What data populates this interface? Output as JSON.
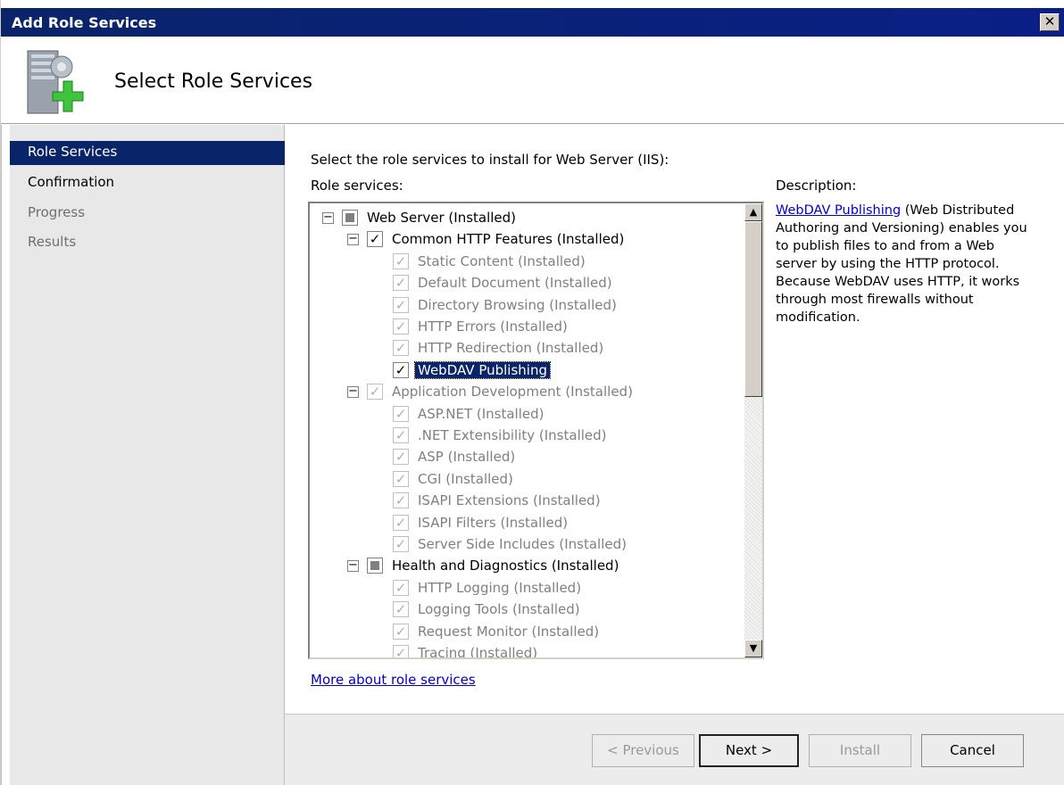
{
  "window": {
    "title": "Add Role Services",
    "close_glyph": "✕"
  },
  "header": {
    "title": "Select Role Services",
    "icon": "server-add-icon"
  },
  "sidebar": {
    "items": [
      {
        "label": "Role Services",
        "state": "active"
      },
      {
        "label": "Confirmation",
        "state": "normal"
      },
      {
        "label": "Progress",
        "state": "disabled"
      },
      {
        "label": "Results",
        "state": "disabled"
      }
    ]
  },
  "main": {
    "intro": "Select the role services to install for Web Server (IIS):",
    "role_services_label": "Role services:",
    "description_label": "Description:",
    "description_link": "WebDAV Publishing",
    "description_text": " (Web Distributed Authoring and Versioning) enables you to publish files to and from a Web server by using the HTTP protocol. Because WebDAV uses HTTP, it works through most firewalls without modification.",
    "more_link": "More about role services"
  },
  "tree": [
    {
      "label": "Web Server  (Installed)",
      "level": 0,
      "expander": "−",
      "check": "partial",
      "grey": false
    },
    {
      "label": "Common HTTP Features  (Installed)",
      "level": 1,
      "expander": "−",
      "check": "checked",
      "grey": false
    },
    {
      "label": "Static Content  (Installed)",
      "level": 2,
      "check": "checked",
      "grey": true
    },
    {
      "label": "Default Document  (Installed)",
      "level": 2,
      "check": "checked",
      "grey": true
    },
    {
      "label": "Directory Browsing  (Installed)",
      "level": 2,
      "check": "checked",
      "grey": true
    },
    {
      "label": "HTTP Errors  (Installed)",
      "level": 2,
      "check": "checked",
      "grey": true
    },
    {
      "label": "HTTP Redirection  (Installed)",
      "level": 2,
      "check": "checked",
      "grey": true
    },
    {
      "label": "WebDAV Publishing",
      "level": 2,
      "check": "checked",
      "grey": false,
      "selected": true
    },
    {
      "label": "Application Development  (Installed)",
      "level": 1,
      "expander": "−",
      "check": "checked",
      "grey": true
    },
    {
      "label": "ASP.NET  (Installed)",
      "level": 2,
      "check": "checked",
      "grey": true
    },
    {
      "label": ".NET Extensibility  (Installed)",
      "level": 2,
      "check": "checked",
      "grey": true
    },
    {
      "label": "ASP  (Installed)",
      "level": 2,
      "check": "checked",
      "grey": true
    },
    {
      "label": "CGI  (Installed)",
      "level": 2,
      "check": "checked",
      "grey": true
    },
    {
      "label": "ISAPI Extensions  (Installed)",
      "level": 2,
      "check": "checked",
      "grey": true
    },
    {
      "label": "ISAPI Filters  (Installed)",
      "level": 2,
      "check": "checked",
      "grey": true
    },
    {
      "label": "Server Side Includes  (Installed)",
      "level": 2,
      "check": "checked",
      "grey": true
    },
    {
      "label": "Health and Diagnostics  (Installed)",
      "level": 1,
      "expander": "−",
      "check": "partial",
      "grey": false
    },
    {
      "label": "HTTP Logging  (Installed)",
      "level": 2,
      "check": "checked",
      "grey": true
    },
    {
      "label": "Logging Tools  (Installed)",
      "level": 2,
      "check": "checked",
      "grey": true
    },
    {
      "label": "Request Monitor  (Installed)",
      "level": 2,
      "check": "checked",
      "grey": true
    },
    {
      "label": "Tracing  (Installed)",
      "level": 2,
      "check": "checked",
      "grey": true
    }
  ],
  "buttons": {
    "previous": "< Previous",
    "next": "Next >",
    "install": "Install",
    "cancel": "Cancel"
  },
  "scroll": {
    "up_glyph": "▲",
    "down_glyph": "▼"
  }
}
